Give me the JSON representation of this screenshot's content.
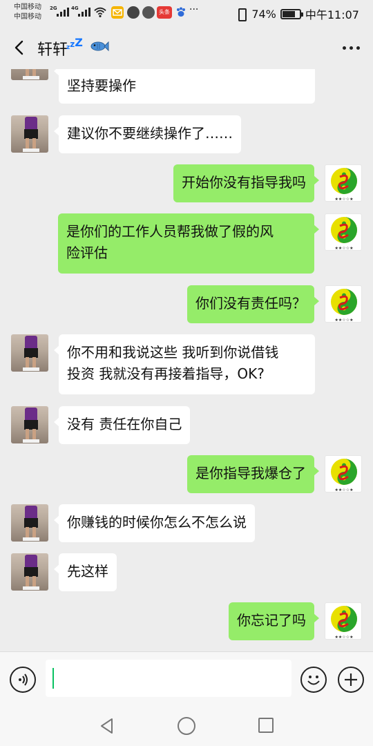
{
  "status_bar": {
    "carrier_1": "中国移动",
    "carrier_2": "中国移动",
    "net_1": "2G",
    "net_2": "4G",
    "notif_icon_label": "头条",
    "dots": "···",
    "battery_percent": "74%",
    "battery_level": 0.74,
    "time": "中午11:07"
  },
  "header": {
    "contact_name": "轩轩",
    "status_sleep": "zzZ",
    "status_emoji": "fish-icon",
    "back_icon": "chevron-left-icon",
    "more_icon": "more-dots-icon"
  },
  "messages": [
    {
      "side": "in",
      "text_partial_top": "",
      "text": "坚持要操作"
    },
    {
      "side": "in",
      "text": "建议你不要继续操作了……"
    },
    {
      "side": "out",
      "text": "开始你没有指导我吗"
    },
    {
      "side": "out",
      "text_line1": "是你们的工作人员帮我做了假的风",
      "text_line2": "险评估"
    },
    {
      "side": "out",
      "text": "你们没有责任吗？"
    },
    {
      "side": "in",
      "text_line1": "你不用和我说这些 我听到你说借钱",
      "text_line2": "投资 我就没有再接着指导，OK?"
    },
    {
      "side": "in",
      "text": "没有 责任在你自己"
    },
    {
      "side": "out",
      "text": "是你指导我爆仓了"
    },
    {
      "side": "in",
      "text": "你赚钱的时候你怎么不怎么说"
    },
    {
      "side": "in",
      "text": "先这样"
    },
    {
      "side": "out",
      "text": "你忘记了吗"
    }
  ],
  "input_bar": {
    "voice_icon": "voice-icon",
    "input_value": "",
    "emoji_icon": "smiley-icon",
    "plus_icon": "plus-icon"
  },
  "nav_bar": {
    "back_icon": "triangle-back-icon",
    "home_icon": "circle-home-icon",
    "recent_icon": "square-recent-icon"
  },
  "colors": {
    "outgoing_bubble": "#95ec69",
    "incoming_bubble": "#ffffff",
    "background": "#ededed",
    "accent": "#07c160"
  }
}
